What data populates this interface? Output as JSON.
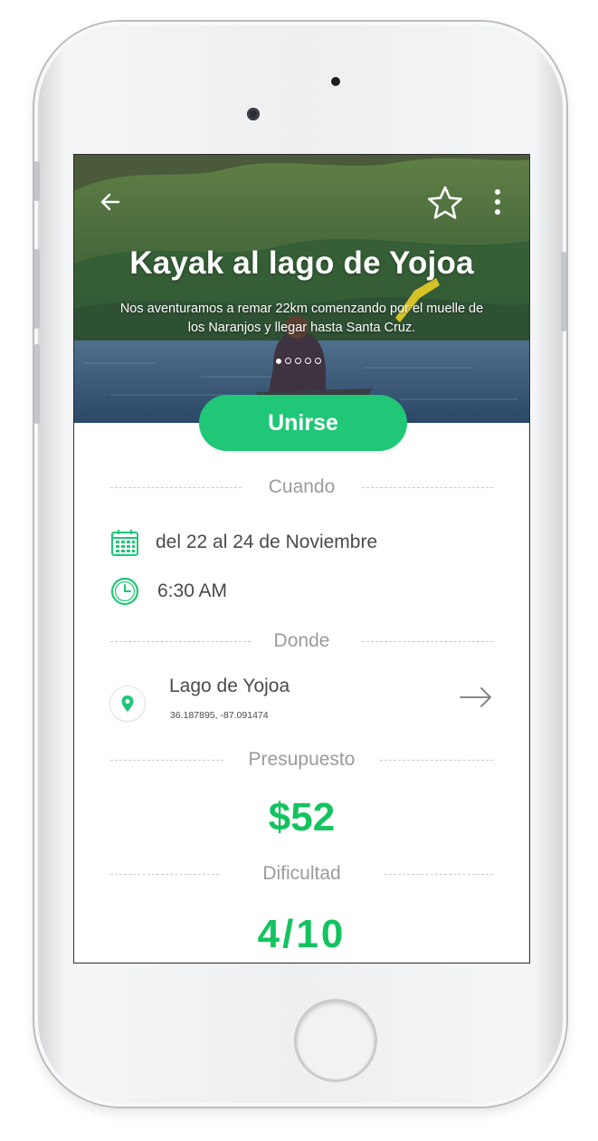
{
  "trip": {
    "title": "Kayak al lago de Yojoa",
    "description": "Nos aventuramos a remar 22km comenzando por el muelle de los Naranjos y llegar hasta Santa Cruz.",
    "join_label": "Unirse",
    "carousel": {
      "count": 5,
      "active_index": 0
    }
  },
  "sections": {
    "when": "Cuando",
    "where": "Donde",
    "budget": "Presupuesto",
    "difficulty": "Dificultad"
  },
  "when": {
    "dates": "del 22 al 24 de Noviembre",
    "time": "6:30 AM"
  },
  "where": {
    "name": "Lago de Yojoa",
    "coordinates": "36.187895, -87.091474"
  },
  "budget": {
    "value": "$52"
  },
  "difficulty": {
    "value": "4/10"
  },
  "icons": {
    "back": "back-arrow-icon",
    "favorite": "star-icon",
    "more": "more-vertical-icon",
    "calendar": "calendar-icon",
    "clock": "clock-icon",
    "pin": "location-pin-icon",
    "navigate": "arrow-right-icon"
  },
  "colors": {
    "accent": "#1fc777",
    "value_green": "#14c35f",
    "label_gray": "#9b9b9b",
    "text_dark": "#4a4a4a"
  }
}
